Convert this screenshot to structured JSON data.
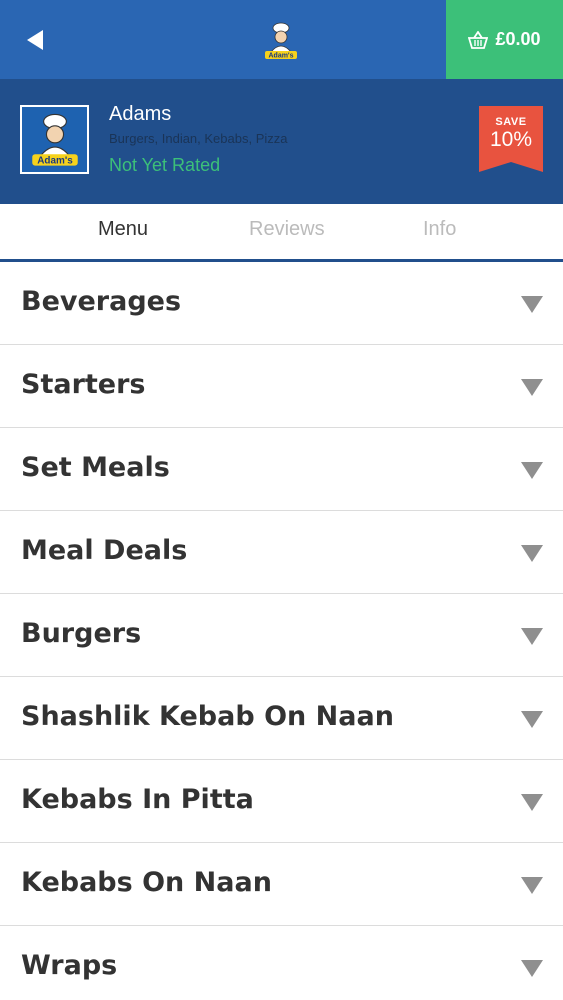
{
  "header": {
    "back_icon": "back-arrow-icon",
    "logo_text": "Adam's",
    "basket_icon": "basket-icon",
    "basket_total": "£0.00"
  },
  "restaurant": {
    "name": "Adams",
    "cuisines": "Burgers, Indian, Kebabs, Pizza",
    "rating": "Not Yet Rated",
    "logo_text": "Adam's",
    "save_label": "SAVE",
    "save_value": "10%"
  },
  "tabs": [
    {
      "label": "Menu",
      "active": true
    },
    {
      "label": "Reviews",
      "active": false
    },
    {
      "label": "Info",
      "active": false
    }
  ],
  "menu": {
    "items": [
      {
        "label": "Beverages"
      },
      {
        "label": "Starters"
      },
      {
        "label": "Set Meals"
      },
      {
        "label": "Meal Deals"
      },
      {
        "label": "Burgers"
      },
      {
        "label": "Shashlik Kebab On Naan"
      },
      {
        "label": "Kebabs In Pitta"
      },
      {
        "label": "Kebabs On Naan"
      },
      {
        "label": "Wraps"
      }
    ],
    "chevron_icon": "chevron-down-icon"
  },
  "colors": {
    "topbar": "#2a66b3",
    "header_bg": "#214f8c",
    "basket_green": "#3cc079",
    "save_red": "#e8533f",
    "rating_green": "#3cc079"
  }
}
